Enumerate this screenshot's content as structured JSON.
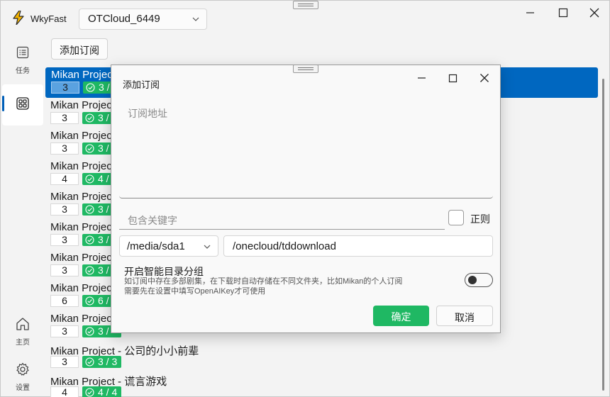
{
  "app": {
    "name": "WkyFast"
  },
  "server_select": {
    "value": "OTCloud_6449"
  },
  "sidebar": {
    "tasks_label": "任务",
    "home_label": "主页",
    "settings_label": "设置"
  },
  "toolbar": {
    "add_label": "添加订阅"
  },
  "list": [
    {
      "title": "Mikan Project",
      "count": "3",
      "status": "3 /"
    },
    {
      "title": "Mikan Project",
      "count": "3",
      "status": "3 /"
    },
    {
      "title": "Mikan Project",
      "count": "3",
      "status": "3 /"
    },
    {
      "title": "Mikan Project",
      "count": "4",
      "status": "4 /"
    },
    {
      "title": "Mikan Project",
      "count": "3",
      "status": "3 /"
    },
    {
      "title": "Mikan Project",
      "count": "3",
      "status": "3 /"
    },
    {
      "title": "Mikan Project",
      "count": "3",
      "status": "3 /"
    },
    {
      "title": "Mikan Project",
      "count": "6",
      "status": "6 /"
    },
    {
      "title": "Mikan Project",
      "count": "3",
      "status": "3 /"
    },
    {
      "title": "Mikan Project - 公司的小小前辈",
      "count": "3",
      "status": "3 / 3"
    },
    {
      "title": "Mikan Project - 谎言游戏",
      "count": "4",
      "status": "4 / 4"
    }
  ],
  "dialog": {
    "title": "添加订阅",
    "url_placeholder": "订阅地址",
    "keyword_placeholder": "包含关键字",
    "regex_label": "正则",
    "drive_value": "/media/sda1",
    "path_value": "/onecloud/tddownload",
    "smart_title": "开启智能目录分组",
    "smart_desc_1": "如订阅中存在多部剧集，在下载时自动存储在不同文件夹，比如Mikan的个人订阅",
    "smart_desc_2": "需要先在设置中填写OpenAIKey才可使用",
    "smart_enabled": false,
    "ok_label": "确定",
    "cancel_label": "取消"
  },
  "colors": {
    "accent": "#0067c0",
    "success": "#1fb863"
  }
}
